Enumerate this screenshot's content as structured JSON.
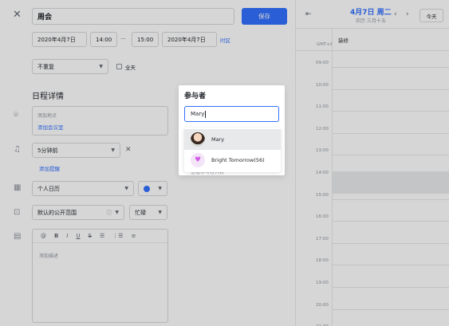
{
  "header": {
    "close_icon": "close-icon",
    "title_value": "周会",
    "save_label": "保存",
    "collapse_icon": "collapse-left-icon",
    "date_main": "4月7日 周二",
    "date_sub": "农历 三月十五",
    "prev_icon": "chevron-left-icon",
    "next_icon": "chevron-right-icon",
    "today_label": "今天"
  },
  "time": {
    "start_date": "2020年4月7日",
    "start_time": "14:00",
    "dash": "—",
    "end_time": "15:00",
    "end_date": "2020年4月7日",
    "timezone_link": "时区"
  },
  "repeat": {
    "value": "不重复",
    "allday_label": "全天"
  },
  "details": {
    "heading": "日程详情",
    "location_placeholder": "添加地点",
    "add_room_link": "添加会议室",
    "reminder_value": "5分钟前",
    "add_reminder_link": "添加提醒",
    "calendar_value": "个人日历",
    "calendar_color": "#3370ff",
    "visibility_value": "默认的公开范围",
    "busy_value": "忙碌",
    "desc_placeholder": "添加描述",
    "toolbar": [
      "@",
      "B",
      "I",
      "U",
      "S",
      "☰",
      "⋮☰",
      "≡"
    ]
  },
  "calendar": {
    "gmt": "GMT+8",
    "allday_event": "装修",
    "hours": [
      "09:00",
      "10:00",
      "11:00",
      "12:00",
      "13:00",
      "14:00",
      "15:00",
      "16:00",
      "17:00",
      "18:00",
      "19:00",
      "20:00",
      "21:00"
    ]
  },
  "attendees": {
    "title": "参与者",
    "input_value": "Mary",
    "options": [
      {
        "name": "Mary",
        "avatar": "photo"
      },
      {
        "name": "Bright Tomorrow(56)",
        "avatar": "heart"
      }
    ],
    "hidden_text": "查看参与者列表"
  }
}
